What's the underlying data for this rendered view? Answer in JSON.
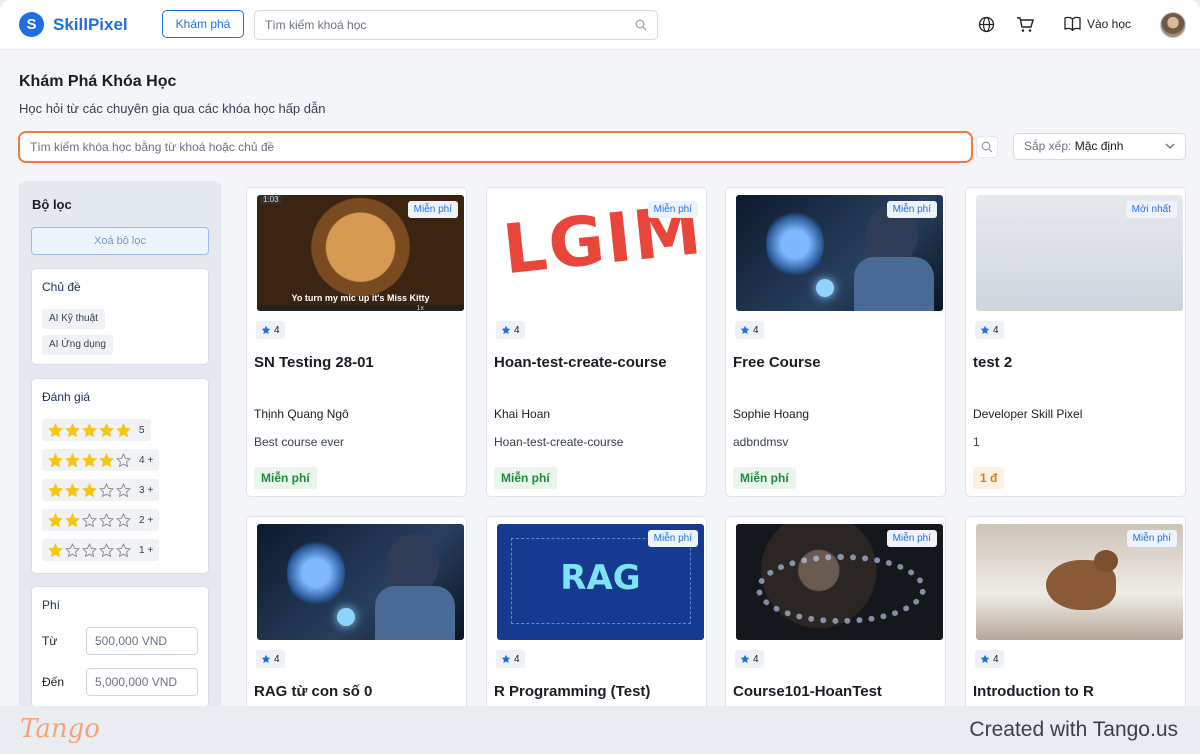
{
  "header": {
    "brand": "SkillPixel",
    "explore_label": "Khám phá",
    "search_placeholder": "Tìm kiếm khoá học",
    "enter_label": "Vào học"
  },
  "page": {
    "title": "Khám Phá Khóa Học",
    "subtitle": "Học hỏi từ các chuyên gia qua các khóa học hấp dẫn",
    "search_placeholder": "Tìm kiếm khóa học bằng từ khoá hoặc chủ đề",
    "sort_label": "Sắp xếp:",
    "sort_value": "Mặc định"
  },
  "sidebar": {
    "title": "Bộ lọc",
    "clear_label": "Xoá bộ lọc",
    "topic_title": "Chủ đề",
    "topics": [
      "AI Kỹ thuật",
      "AI Ứng dụng"
    ],
    "rating_title": "Đánh giá",
    "ratings": [
      {
        "stars": 5,
        "label": "5"
      },
      {
        "stars": 4,
        "label": "4 +"
      },
      {
        "stars": 3,
        "label": "3 +"
      },
      {
        "stars": 2,
        "label": "2 +"
      },
      {
        "stars": 1,
        "label": "1 +"
      }
    ],
    "price_title": "Phí",
    "from_label": "Từ",
    "to_label": "Đến",
    "from_placeholder": "500,000 VND",
    "to_placeholder": "5,000,000 VND"
  },
  "courses": [
    {
      "title": "SN Testing 28-01",
      "author": "Thịnh Quang Ngô",
      "desc": "Best course ever",
      "price": "Miễn phí",
      "badge": "Miễn phí",
      "rating": "4",
      "thumb_caption": "Yo turn my mic up it's Miss Kitty",
      "thumb_time": "1:03",
      "thumb_speed": "1x"
    },
    {
      "title": "Hoan-test-create-course",
      "author": "Khai Hoan",
      "desc": "Hoan-test-create-course",
      "price": "Miễn phí",
      "badge": "Miễn phí",
      "rating": "4",
      "thumb_text": "LGIM"
    },
    {
      "title": "Free Course",
      "author": "Sophie Hoang",
      "desc": "adbndmsv",
      "price": "Miễn phí",
      "badge": "Miễn phí",
      "rating": "4"
    },
    {
      "title": "test 2",
      "author": "Developer Skill Pixel",
      "desc": "1",
      "price": "1 đ",
      "badge": "Mới nhất",
      "rating": "4"
    },
    {
      "title": "RAG từ con số 0",
      "rating": "4"
    },
    {
      "title": "R Programming (Test)",
      "badge": "Miễn phí",
      "rating": "4",
      "thumb_text": "RAG"
    },
    {
      "title": "Course101-HoanTest",
      "badge": "Miễn phí",
      "rating": "4"
    },
    {
      "title": "Introduction to R",
      "badge": "Miễn phí",
      "rating": "4"
    }
  ],
  "footer": {
    "logo": "Tango",
    "credit": "Created with Tango.us"
  },
  "colors": {
    "accent": "#1f6fe0",
    "search_focus": "#f07a3c",
    "star": "#f5c518",
    "free": "#1f8a3c",
    "paid": "#e07b1a"
  }
}
